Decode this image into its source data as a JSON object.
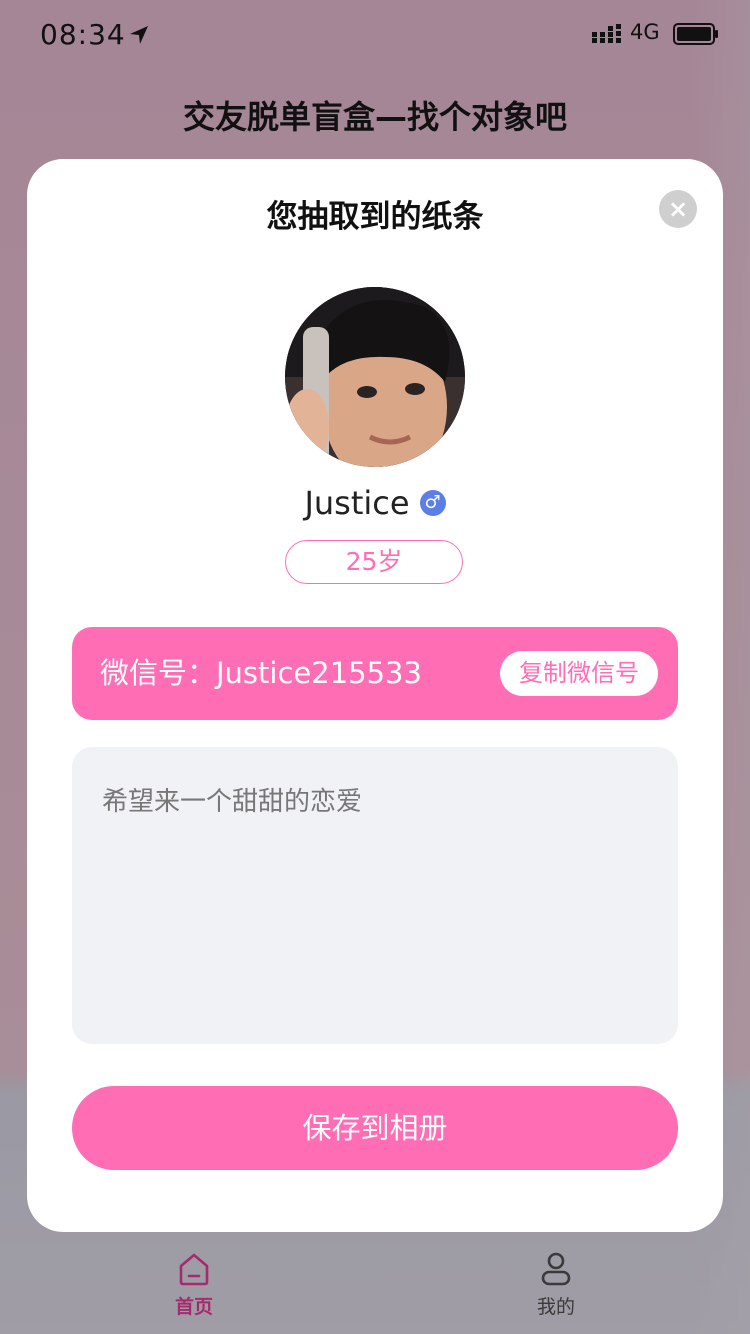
{
  "status": {
    "time": "08:34",
    "network": "4G"
  },
  "page": {
    "title": "交友脱单盲盒—找个对象吧"
  },
  "modal": {
    "title": "您抽取到的纸条",
    "close_symbol": "×",
    "profile": {
      "name": "Justice",
      "gender_symbol": "♂",
      "age": "25岁"
    },
    "wechat": {
      "label": "微信号：Justice215533",
      "copy_button": "复制微信号"
    },
    "message": "希望来一个甜甜的恋爱",
    "save_button": "保存到相册"
  },
  "tabbar": {
    "items": [
      {
        "label": "首页",
        "icon": "home-icon",
        "active": true
      },
      {
        "label": "我的",
        "icon": "user-icon",
        "active": false
      }
    ]
  },
  "colors": {
    "accent": "#ff6db4",
    "gender_male": "#5b7ee8",
    "tab_active": "#a52b6e"
  }
}
